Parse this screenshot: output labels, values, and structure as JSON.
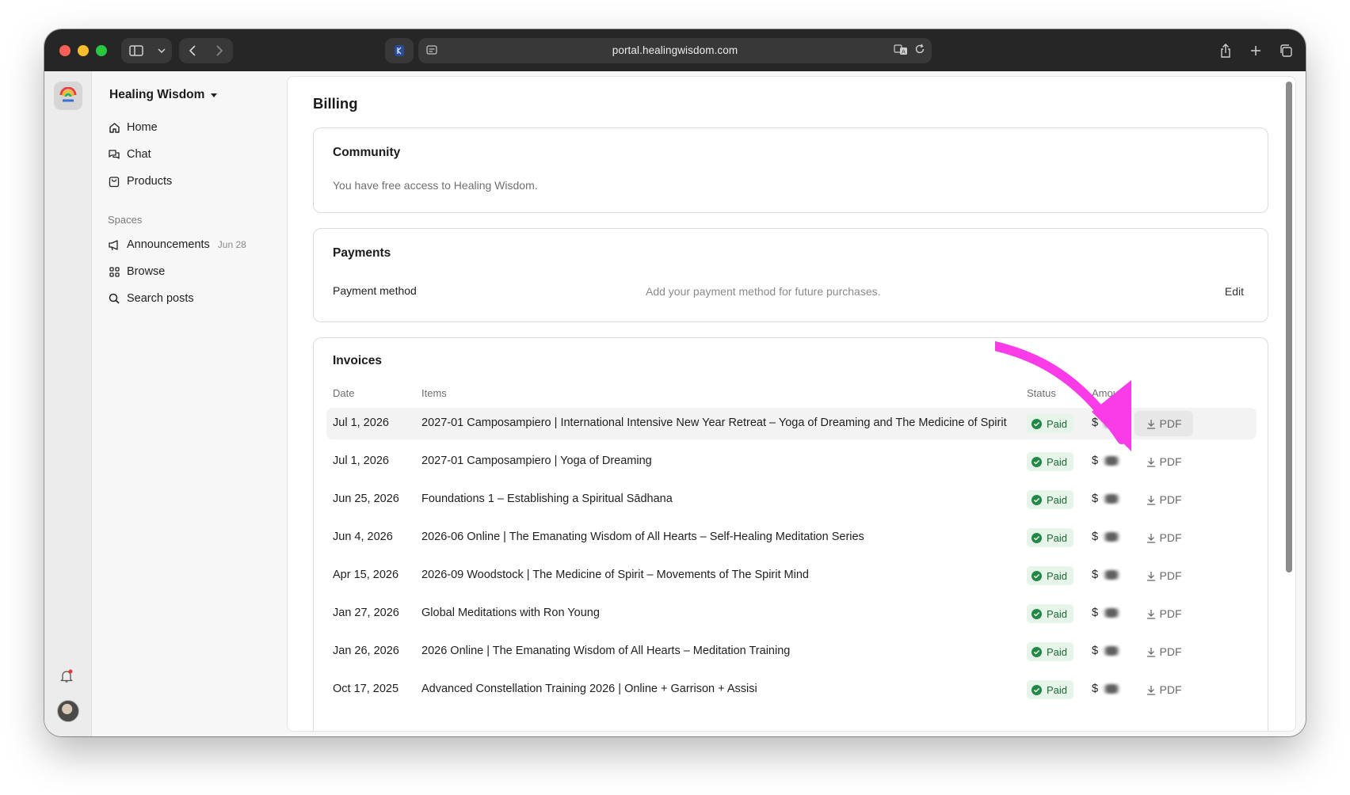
{
  "browser": {
    "url": "portal.healingwisdom.com"
  },
  "sidebar": {
    "workspace": "Healing Wisdom",
    "nav": [
      {
        "label": "Home",
        "icon": "home-icon"
      },
      {
        "label": "Chat",
        "icon": "chat-icon"
      },
      {
        "label": "Products",
        "icon": "bag-icon"
      }
    ],
    "spaces_label": "Spaces",
    "spaces": [
      {
        "label": "Announcements",
        "icon": "megaphone-icon",
        "date": "Jun 28"
      },
      {
        "label": "Browse",
        "icon": "grid-icon"
      },
      {
        "label": "Search posts",
        "icon": "search-icon"
      }
    ]
  },
  "page": {
    "title": "Billing",
    "community": {
      "title": "Community",
      "text": "You have free access to Healing Wisdom."
    },
    "payments": {
      "title": "Payments",
      "method_label": "Payment method",
      "method_text": "Add your payment method for future purchases.",
      "edit_label": "Edit"
    },
    "invoices": {
      "title": "Invoices",
      "columns": {
        "date": "Date",
        "items": "Items",
        "status": "Status",
        "amount": "Amount"
      },
      "pdf_label": "PDF",
      "rows": [
        {
          "date": "Jul 1, 2026",
          "item": "2027-01 Camposampiero | International Intensive New Year Retreat – Yoga of Dreaming and The Medicine of Spirit",
          "status": "Paid",
          "amount_prefix": "$"
        },
        {
          "date": "Jul 1, 2026",
          "item": "2027-01 Camposampiero | Yoga of Dreaming",
          "status": "Paid",
          "amount_prefix": "$"
        },
        {
          "date": "Jun 25, 2026",
          "item": "Foundations 1 – Establishing a Spiritual Sādhana",
          "status": "Paid",
          "amount_prefix": "$"
        },
        {
          "date": "Jun 4, 2026",
          "item": "2026-06 Online | The Emanating Wisdom of All Hearts – Self-Healing Meditation Series",
          "status": "Paid",
          "amount_prefix": "$"
        },
        {
          "date": "Apr 15, 2026",
          "item": "2026-09 Woodstock | The Medicine of Spirit – Movements of The Spirit Mind",
          "status": "Paid",
          "amount_prefix": "$"
        },
        {
          "date": "Jan 27, 2026",
          "item": "Global Meditations with Ron Young",
          "status": "Paid",
          "amount_prefix": "$"
        },
        {
          "date": "Jan 26, 2026",
          "item": "2026 Online | The Emanating Wisdom of All Hearts – Meditation Training",
          "status": "Paid",
          "amount_prefix": "$"
        },
        {
          "date": "Oct 17, 2025",
          "item": "Advanced Constellation Training 2026 | Online + Garrison + Assisi",
          "status": "Paid",
          "amount_prefix": "$"
        }
      ]
    }
  },
  "colors": {
    "annotation_arrow": "#f93ce8",
    "paid_badge_bg": "#e6f4ea",
    "paid_badge_text": "#1d6b35"
  }
}
